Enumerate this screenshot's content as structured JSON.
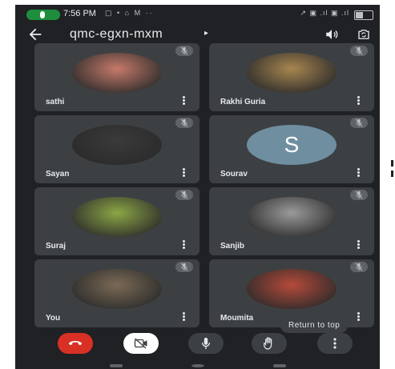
{
  "status_bar": {
    "time": "7:56 PM",
    "left_icons": "▢ • ⌂ M ··",
    "right_icons": "↗ ▣ .ıl ▣ .ıl"
  },
  "header": {
    "meeting_code": "qmc-egxn-mxm",
    "chevron": "▸"
  },
  "participants": [
    {
      "name": "sathi",
      "avatar_color": "#c67a6a"
    },
    {
      "name": "Rakhi Guria",
      "avatar_color": "#a8864f"
    },
    {
      "name": "Sayan",
      "avatar_color": "#3a3a3a"
    },
    {
      "name": "Sourav",
      "initial": "S",
      "avatar_color": "#6f8fa1"
    },
    {
      "name": "Suraj",
      "avatar_color": "#8ca645"
    },
    {
      "name": "Sanjib",
      "avatar_color": "#9a9a9a"
    },
    {
      "name": "You",
      "avatar_color": "#7a6a55"
    },
    {
      "name": "Moumita",
      "avatar_color": "#b54a3a"
    }
  ],
  "return_to_top_label": "Return to top",
  "colors": {
    "background": "#202124",
    "tile": "#3c4043",
    "end_call": "#d93025",
    "accent_green": "#1e8e3e"
  },
  "icons": {
    "back": "back-arrow-icon",
    "speaker": "speaker-icon",
    "switch_camera": "switch-camera-icon",
    "mic_off": "mic-off-icon",
    "end_call": "phone-hangup-icon",
    "camera_off": "camera-off-icon",
    "mic": "mic-icon",
    "raise_hand": "hand-icon",
    "more": "more-vert-icon"
  }
}
